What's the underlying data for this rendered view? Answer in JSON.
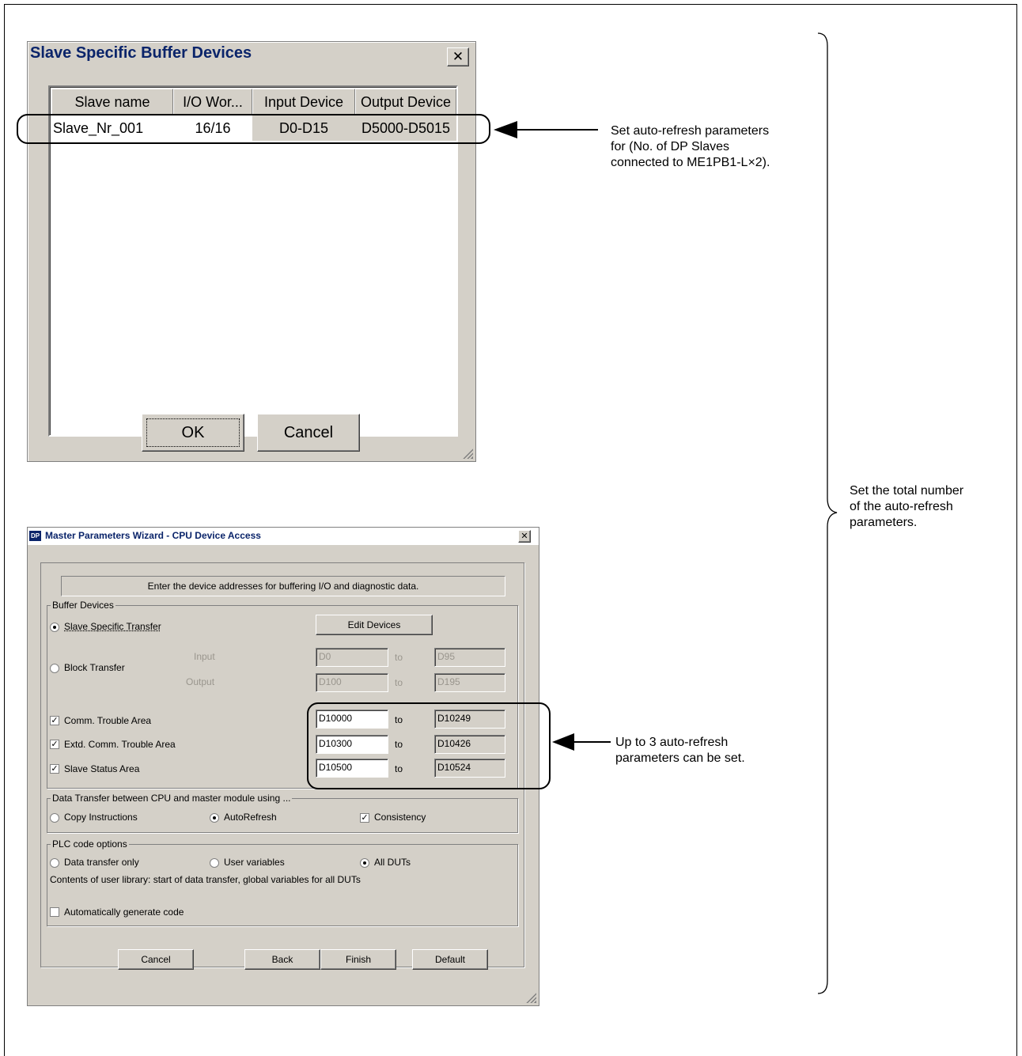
{
  "slave_dialog": {
    "title": "Slave Specific Buffer Devices",
    "close_glyph": "✕",
    "columns": [
      "Slave name",
      "I/O Wor...",
      "Input Device",
      "Output Device"
    ],
    "rows": [
      {
        "slave_name": "Slave_Nr_001",
        "io_words": "16/16",
        "input_device": "D0-D15",
        "output_device": "D5000-D5015"
      }
    ],
    "ok_label": "OK",
    "cancel_label": "Cancel"
  },
  "annotations": {
    "slave_row_note": "Set auto-refresh parameters\nfor (No. of DP Slaves\nconnected to ME1PB1-L×2).",
    "total_note": "Set the total number\nof the auto-refresh\nparameters.",
    "area_note": "Up to 3 auto-refresh\nparameters can be set."
  },
  "wizard": {
    "icon_label": "DP",
    "title": "Master Parameters Wizard - CPU Device Access",
    "close_glyph": "✕",
    "instruction": "Enter the device addresses for buffering I/O and diagnostic data.",
    "buffer_devices": {
      "legend": "Buffer Devices",
      "slave_specific_label": "Slave Specific Transfer",
      "edit_devices_label": "Edit Devices",
      "block_transfer_label": "Block Transfer",
      "input_label": "Input",
      "output_label": "Output",
      "to_label": "to",
      "block_input_from": "D0",
      "block_input_to": "D95",
      "block_output_from": "D100",
      "block_output_to": "D195",
      "comm_trouble_label": "Comm. Trouble Area",
      "comm_trouble_from": "D10000",
      "comm_trouble_to": "D10249",
      "extd_comm_trouble_label": "Extd. Comm. Trouble Area",
      "extd_comm_trouble_from": "D10300",
      "extd_comm_trouble_to": "D10426",
      "slave_status_label": "Slave Status Area",
      "slave_status_from": "D10500",
      "slave_status_to": "D10524"
    },
    "data_transfer": {
      "legend": "Data Transfer between CPU and master module using ...",
      "copy_label": "Copy Instructions",
      "autorefresh_label": "AutoRefresh",
      "consistency_label": "Consistency"
    },
    "plc_options": {
      "legend": "PLC code options",
      "data_transfer_only_label": "Data transfer only",
      "user_variables_label": "User variables",
      "all_duts_label": "All DUTs",
      "contents_text": "Contents of user library: start of data transfer, global variables for all DUTs",
      "auto_generate_label": "Automatically generate code"
    },
    "buttons": {
      "cancel": "Cancel",
      "back": "Back",
      "finish": "Finish",
      "default": "Default"
    }
  },
  "check_glyph": "✓"
}
